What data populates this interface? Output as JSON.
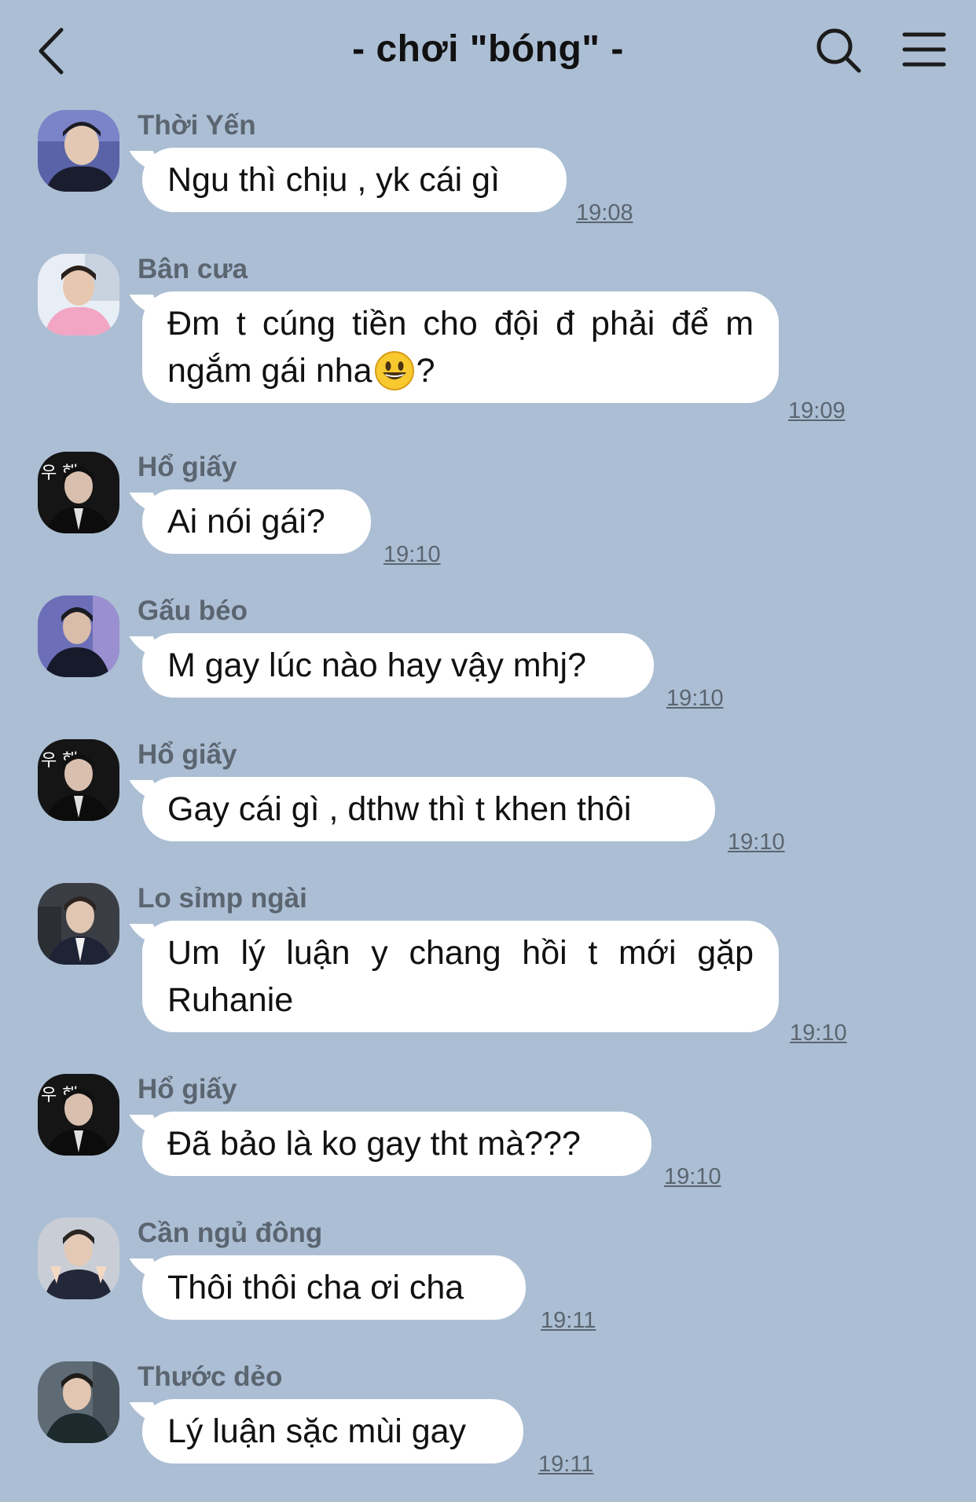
{
  "header": {
    "title": "- chơi \"bóng\" -",
    "back_icon": "chevron-left-icon",
    "search_icon": "search-icon",
    "menu_icon": "hamburger-menu-icon"
  },
  "messages": [
    {
      "sender": "Thời Yến",
      "text": "Ngu thì chịu , yk cái gì",
      "time": "19:08"
    },
    {
      "sender": "Bân cưa",
      "text_line1": "Đm t cúng tiền cho đội đ phải để",
      "text_line2_before": "m ngắm gái nha",
      "text_line2_after": "?",
      "emoji": "grinning-face-emoji",
      "time": "19:09"
    },
    {
      "sender": "Hổ giấy",
      "text": "Ai nói gái?",
      "time": "19:10"
    },
    {
      "sender": "Gấu béo",
      "text": "M gay lúc nào hay vậy mhj?",
      "time": "19:10"
    },
    {
      "sender": "Hổ giấy",
      "text": "Gay cái gì , dthw thì t khen thôi",
      "time": "19:10"
    },
    {
      "sender": "Lo sỉmp ngài",
      "text": "Um lý luận y chang hồi t mới gặp Ruhanie",
      "time": "19:10"
    },
    {
      "sender": "Hổ giấy",
      "text": "Đã bảo là ko gay tht mà???",
      "time": "19:10"
    },
    {
      "sender": "Cần ngủ đông",
      "text": "Thôi thôi cha ơi cha",
      "time": "19:11"
    },
    {
      "sender": "Thước dẻo",
      "text": "Lý luận sặc mùi gay",
      "time": "19:11"
    }
  ],
  "colors": {
    "background": "#abbed4",
    "bubble": "#ffffff",
    "meta_text": "#5b6570",
    "title_text": "#111111"
  }
}
